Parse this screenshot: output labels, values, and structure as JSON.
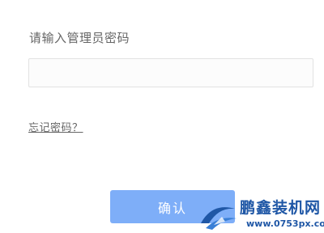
{
  "login": {
    "prompt": "请输入管理员密码",
    "password_value": "",
    "forgot_link": "忘记密码？",
    "confirm_label": "确认"
  },
  "watermark": {
    "brand": "鹏鑫装机网",
    "url": "www.0753px.com",
    "logo_icon": "blue-swoosh-logo",
    "color": "#1f57a6"
  },
  "colors": {
    "button_bg": "#7eaef8",
    "label_text": "#666666",
    "input_border": "#e2e2e2"
  }
}
